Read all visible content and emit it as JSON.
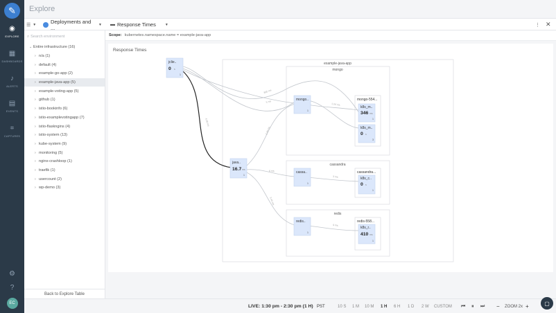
{
  "header": {
    "title": "Explore"
  },
  "rail": {
    "items": [
      {
        "label": "EXPLORE",
        "icon": "explore-icon"
      },
      {
        "label": "DASHBOARDS",
        "icon": "dashboards-icon"
      },
      {
        "label": "ALERTS",
        "icon": "alerts-icon"
      },
      {
        "label": "EVENTS",
        "icon": "events-icon"
      },
      {
        "label": "CAPTURES",
        "icon": "captures-icon"
      }
    ],
    "avatar": "EC"
  },
  "toolbar": {
    "grouping_label": "Deployments and ...",
    "view_label": "Response Times"
  },
  "sidebar": {
    "search_placeholder": "Search environment",
    "root": "Entire infrastructure (16)",
    "items": [
      "n/a (1)",
      "default (4)",
      "example-go-app (2)",
      "example-java-app (5)",
      "example-voting-app (5)",
      "github (1)",
      "istio-bookinfo (6)",
      "istio-examplevotingapp (7)",
      "istio-flaskngins (4)",
      "istio-system (13)",
      "kube-system (9)",
      "monitoring (5)",
      "nginx-crashloop (1)",
      "traefik (1)",
      "usercount (2)",
      "wp-demo (3)"
    ],
    "selected_index": 3,
    "back_link": "Back to Explore Table"
  },
  "scope": {
    "label": "Scope:",
    "value": "kubernetes.namespace.name = example-java-app"
  },
  "panel": {
    "title": "Response Times"
  },
  "graph": {
    "outer_group": "example-java-app",
    "groups": [
      "mongo",
      "cassandra",
      "redis"
    ],
    "nodes": {
      "client": {
        "name": "jclie..",
        "value": "0",
        "unit": "s",
        "count": "1"
      },
      "java": {
        "name": "java..",
        "value": "16.7",
        "unit": "ms",
        "count": "1"
      },
      "mongo_svc": {
        "name": "mongo..",
        "count": "1"
      },
      "mongo_pod": {
        "name": "mongo-554...",
        "count": "1"
      },
      "mongo_k1": {
        "name": "k8s_m..",
        "value": "346",
        "unit": "ms",
        "count": "1"
      },
      "mongo_k2": {
        "name": "k8s_m..",
        "value": "0",
        "unit": "s",
        "count": "3"
      },
      "cass_svc": {
        "name": "cassa..",
        "count": "1"
      },
      "cass_pod": {
        "name": "cassandra...",
        "count": "1"
      },
      "cass_k": {
        "name": "k8s_c..",
        "value": "0",
        "unit": "s",
        "count": "1"
      },
      "redis_svc": {
        "name": "redis..",
        "count": "1"
      },
      "redis_pod": {
        "name": "redis-558...",
        "count": "1"
      },
      "redis_k": {
        "name": "k8s_r..",
        "value": "410",
        "unit": "ms",
        "count": "1"
      }
    },
    "edge_labels": {
      "e1": "865 ms",
      "e2": "5 ms",
      "e3": "4.08 ms",
      "e4": "2.46 ms",
      "e5": "6 ms",
      "e6": "3.44 ms",
      "e7": "1.04 ms",
      "e8": "3 ms",
      "e9": "9 ms"
    }
  },
  "statusbar": {
    "live": "LIVE: 1:30 pm - 2:30 pm (1 H)",
    "tz": "PST",
    "ranges": [
      "10 S",
      "1 M",
      "10 M",
      "1 H",
      "6 H",
      "1 D",
      "2 W",
      "CUSTOM"
    ],
    "active_range": "1 H",
    "zoom": "ZOOM 2x"
  }
}
